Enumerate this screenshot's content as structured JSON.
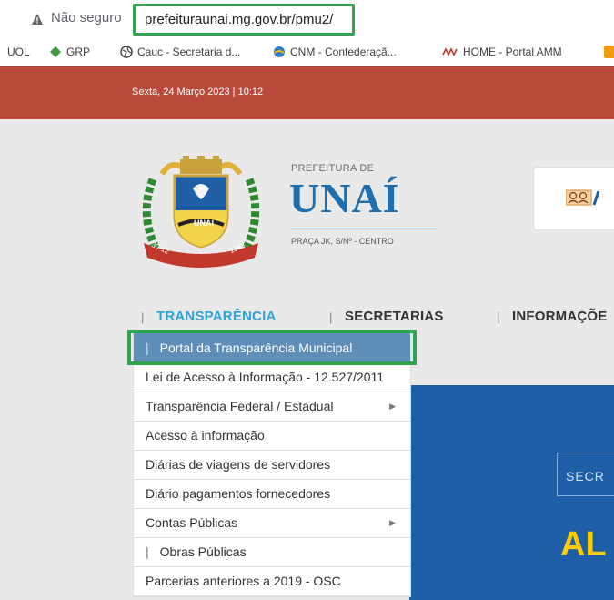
{
  "browser": {
    "security_label": "Não seguro",
    "url": "prefeituraunai.mg.gov.br/pmu2/"
  },
  "bookmarks": [
    {
      "label": "UOL",
      "icon": "none"
    },
    {
      "label": "GRP",
      "icon": "green-diamond-icon"
    },
    {
      "label": "Cauc - Secretaria d...",
      "icon": "globe-icon"
    },
    {
      "label": "CNM - Confederaçã...",
      "icon": "cnm-logo-icon"
    },
    {
      "label": "HOME - Portal AMM",
      "icon": "amm-logo-icon"
    }
  ],
  "site": {
    "date": "Sexta, 24 Março 2023 | 10:12",
    "prefeitura_label": "PREFEITURA DE",
    "city": "UNAÍ",
    "address": "PRAÇA JK, S/Nº - CENTRO",
    "crest_text": {
      "name": "UNAI",
      "left_year": "30-12",
      "right_year": "1943"
    },
    "nav": [
      {
        "label": "TRANSPARÊNCIA",
        "active": true
      },
      {
        "label": "SECRETARIAS",
        "active": false
      },
      {
        "label": "INFORMAÇÕE",
        "active": false
      }
    ],
    "banner": {
      "secr": "SECR",
      "big": "AL"
    }
  },
  "dropdown": [
    {
      "label": "Portal da Transparência Municipal",
      "highlighted": true,
      "submenu": false,
      "pipe": true
    },
    {
      "label": "Lei de Acesso à Informação - 12.527/2011",
      "submenu": false
    },
    {
      "label": "Transparência Federal / Estadual",
      "submenu": true
    },
    {
      "label": "Acesso à informação",
      "submenu": false
    },
    {
      "label": "Diárias de viagens de servidores",
      "submenu": false
    },
    {
      "label": "Diário pagamentos fornecedores",
      "submenu": false
    },
    {
      "label": "Contas Públicas",
      "submenu": true
    },
    {
      "label": "Obras Públicas",
      "submenu": false,
      "pipe": true
    },
    {
      "label": "Parcerias anteriores a 2019 - OSC",
      "submenu": false
    }
  ],
  "colors": {
    "topbar": "#b9493b",
    "highlight": "#2ea44f",
    "accent": "#2ea3d6",
    "brand": "#1e6fb0"
  }
}
